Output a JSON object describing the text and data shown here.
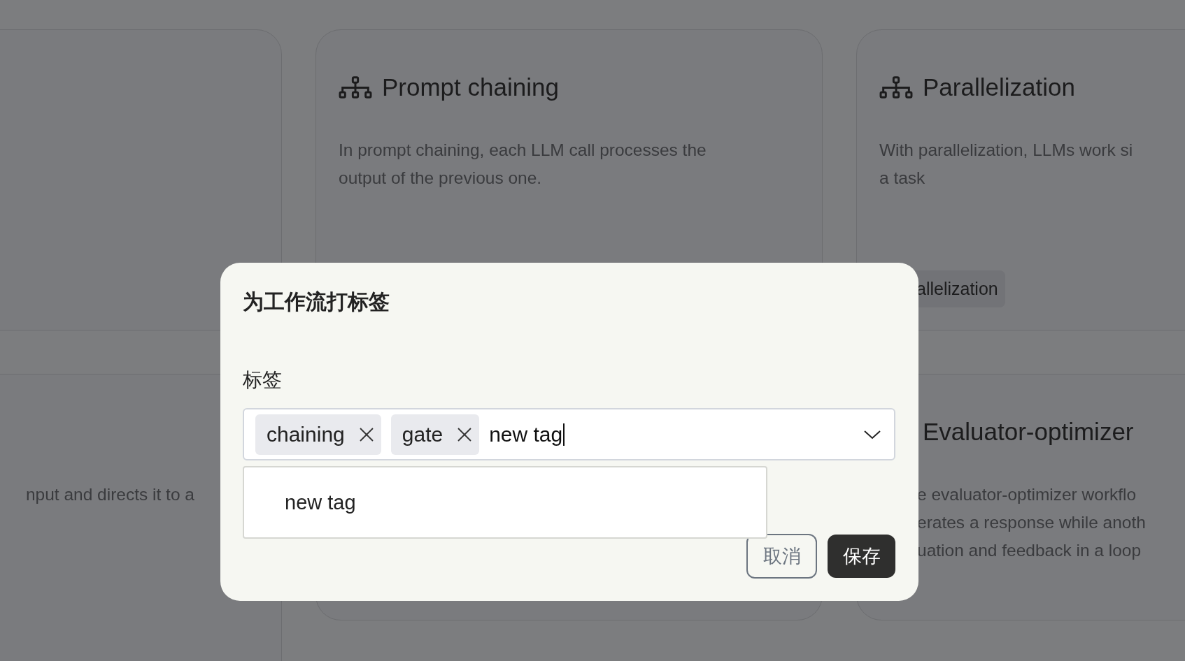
{
  "card_rows": [
    [
      {},
      {
        "icon": true,
        "title": "Prompt chaining",
        "description": [
          "In prompt chaining, each LLM call processes the",
          "output of the previous one."
        ]
      },
      {
        "icon": true,
        "title": "Parallelization",
        "description": [
          "With parallelization, LLMs work si",
          "a task"
        ],
        "tags": [
          "allelization"
        ]
      }
    ],
    [
      {
        "description": [
          "nput and directs it to a"
        ]
      },
      {},
      {
        "title": "Evaluator-optimizer",
        "description": [
          "e evaluator-optimizer workflo",
          "erates a response while anoth",
          "uation and feedback in a loop"
        ]
      }
    ]
  ],
  "dialog": {
    "title": "为工作流打标签",
    "field_label": "标签",
    "tags": [
      {
        "label": "chaining"
      },
      {
        "label": "gate"
      }
    ],
    "value": "new tag",
    "focused": true,
    "suggestions": [
      "new tag"
    ],
    "buttons": [
      {
        "label": "取消",
        "kind": "secondary"
      },
      {
        "label": "保存",
        "kind": "primary"
      }
    ]
  }
}
